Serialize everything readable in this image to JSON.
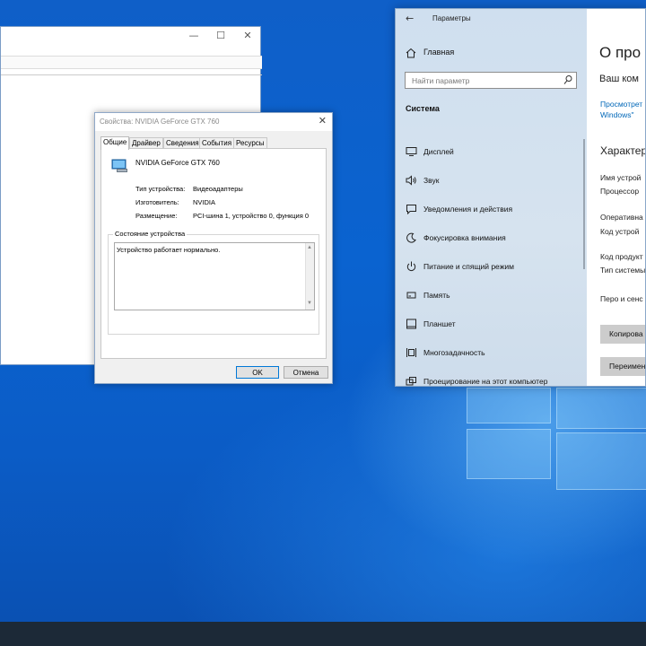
{
  "props_dialog": {
    "title": "Свойства: NVIDIA GeForce GTX 760",
    "tabs": [
      "Общие",
      "Драйвер",
      "Сведения",
      "События",
      "Ресурсы"
    ],
    "device_name": "NVIDIA GeForce GTX 760",
    "fields": [
      {
        "label": "Тип устройства:",
        "value": "Видеоадаптеры"
      },
      {
        "label": "Изготовитель:",
        "value": "NVIDIA"
      },
      {
        "label": "Размещение:",
        "value": "PCI-шина 1, устройство 0, функция 0"
      }
    ],
    "status_group_title": "Состояние устройства",
    "status_text": "Устройство работает нормально.",
    "ok_label": "OK",
    "cancel_label": "Отмена"
  },
  "settings": {
    "app_title": "Параметры",
    "home_label": "Главная",
    "search_placeholder": "Найти параметр",
    "section_title": "Система",
    "nav_items": [
      {
        "label": "Дисплей",
        "icon": "display-icon"
      },
      {
        "label": "Звук",
        "icon": "sound-icon"
      },
      {
        "label": "Уведомления и действия",
        "icon": "notifications-icon"
      },
      {
        "label": "Фокусировка внимания",
        "icon": "focus-assist-icon"
      },
      {
        "label": "Питание и спящий режим",
        "icon": "power-icon"
      },
      {
        "label": "Память",
        "icon": "storage-icon"
      },
      {
        "label": "Планшет",
        "icon": "tablet-icon"
      },
      {
        "label": "Многозадачность",
        "icon": "multitasking-icon"
      },
      {
        "label": "Проецирование на этот компьютер",
        "icon": "projecting-icon"
      }
    ],
    "content": {
      "heading": "О про",
      "subheading": "Ваш ком",
      "link_line1": "Просмотрет",
      "link_line2": "Windows\"",
      "specs_heading": "Характер",
      "rows": [
        "Имя устрой",
        "Процессор",
        "Оперативна",
        "Код устрой",
        "Код продукт",
        "Тип системы",
        "Перо и сенс"
      ],
      "copy_button": "Копирова",
      "rename_button": "Переимен"
    }
  },
  "colors": {
    "desktop_blue": "#0b5cc6",
    "settings_nav": "#d3e1ef",
    "link": "#0067b8",
    "taskbar": "#1c2937"
  }
}
